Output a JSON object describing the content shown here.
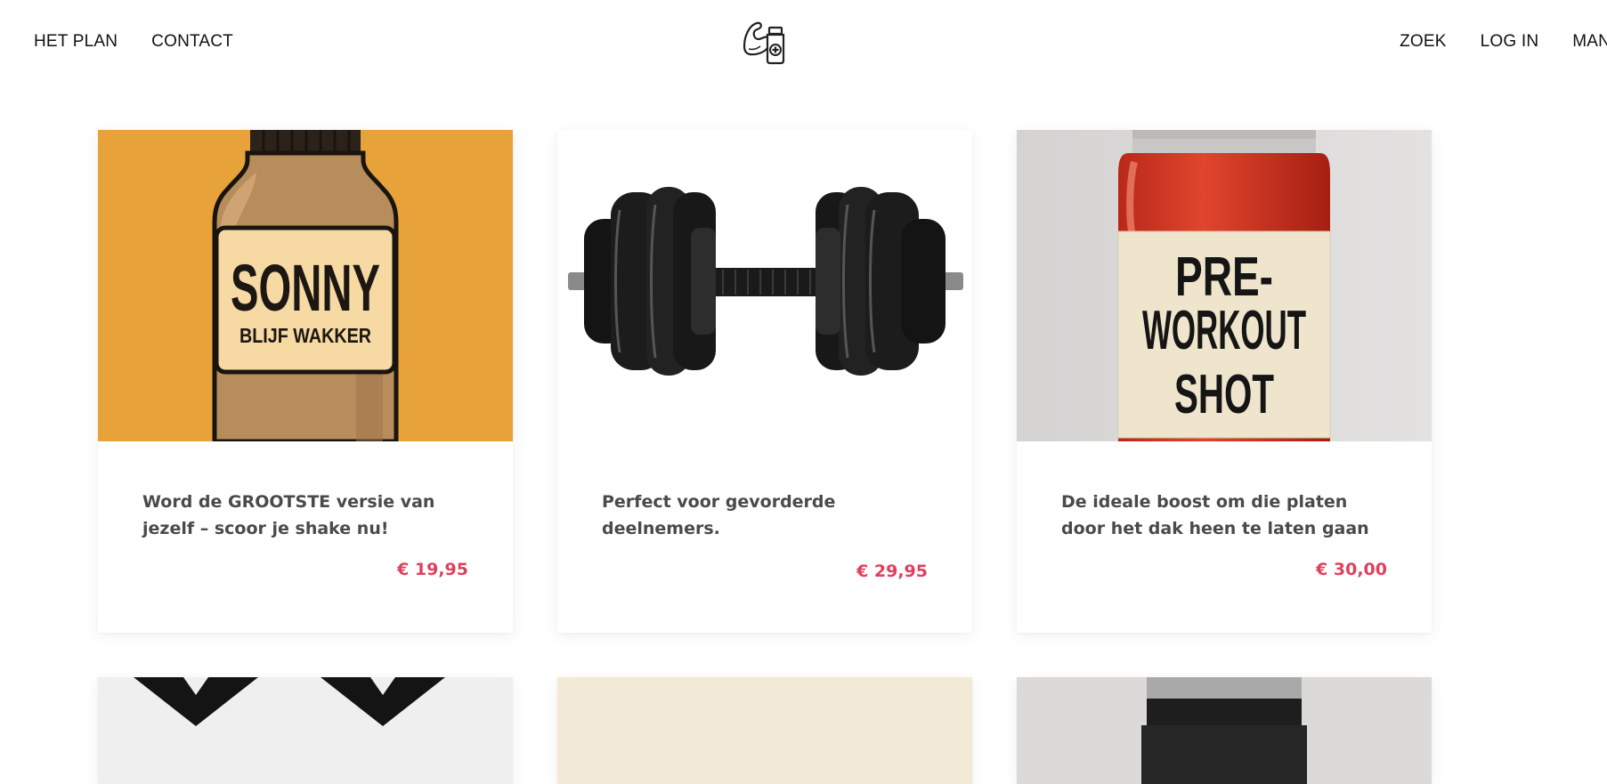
{
  "nav": {
    "left": [
      "HET PLAN",
      "CONTACT"
    ],
    "right": [
      "ZOEK",
      "LOG IN",
      "MAND"
    ]
  },
  "logo_icon": "muscle-arm-pill-bottle-icon",
  "colors": {
    "price": "#e0405e",
    "desc": "#4a4a4a",
    "card1_bg": "#e8a23a",
    "card3_bg": "#dedcdb"
  },
  "products": [
    {
      "image_label": [
        "SONNY",
        "BLIJF WAKKER"
      ],
      "description": "Word de GROOTSTE versie van jezelf – scoor je shake nu!",
      "price": "€ 19,95"
    },
    {
      "image_label": [],
      "description": "Perfect voor gevorderde deelnemers.",
      "price": "€ 29,95"
    },
    {
      "image_label": [
        "PRE-",
        "WORKOUT",
        "SHOT"
      ],
      "description": "De ideale boost om die platen door het dak heen te laten gaan",
      "price": "€ 30,00"
    }
  ]
}
